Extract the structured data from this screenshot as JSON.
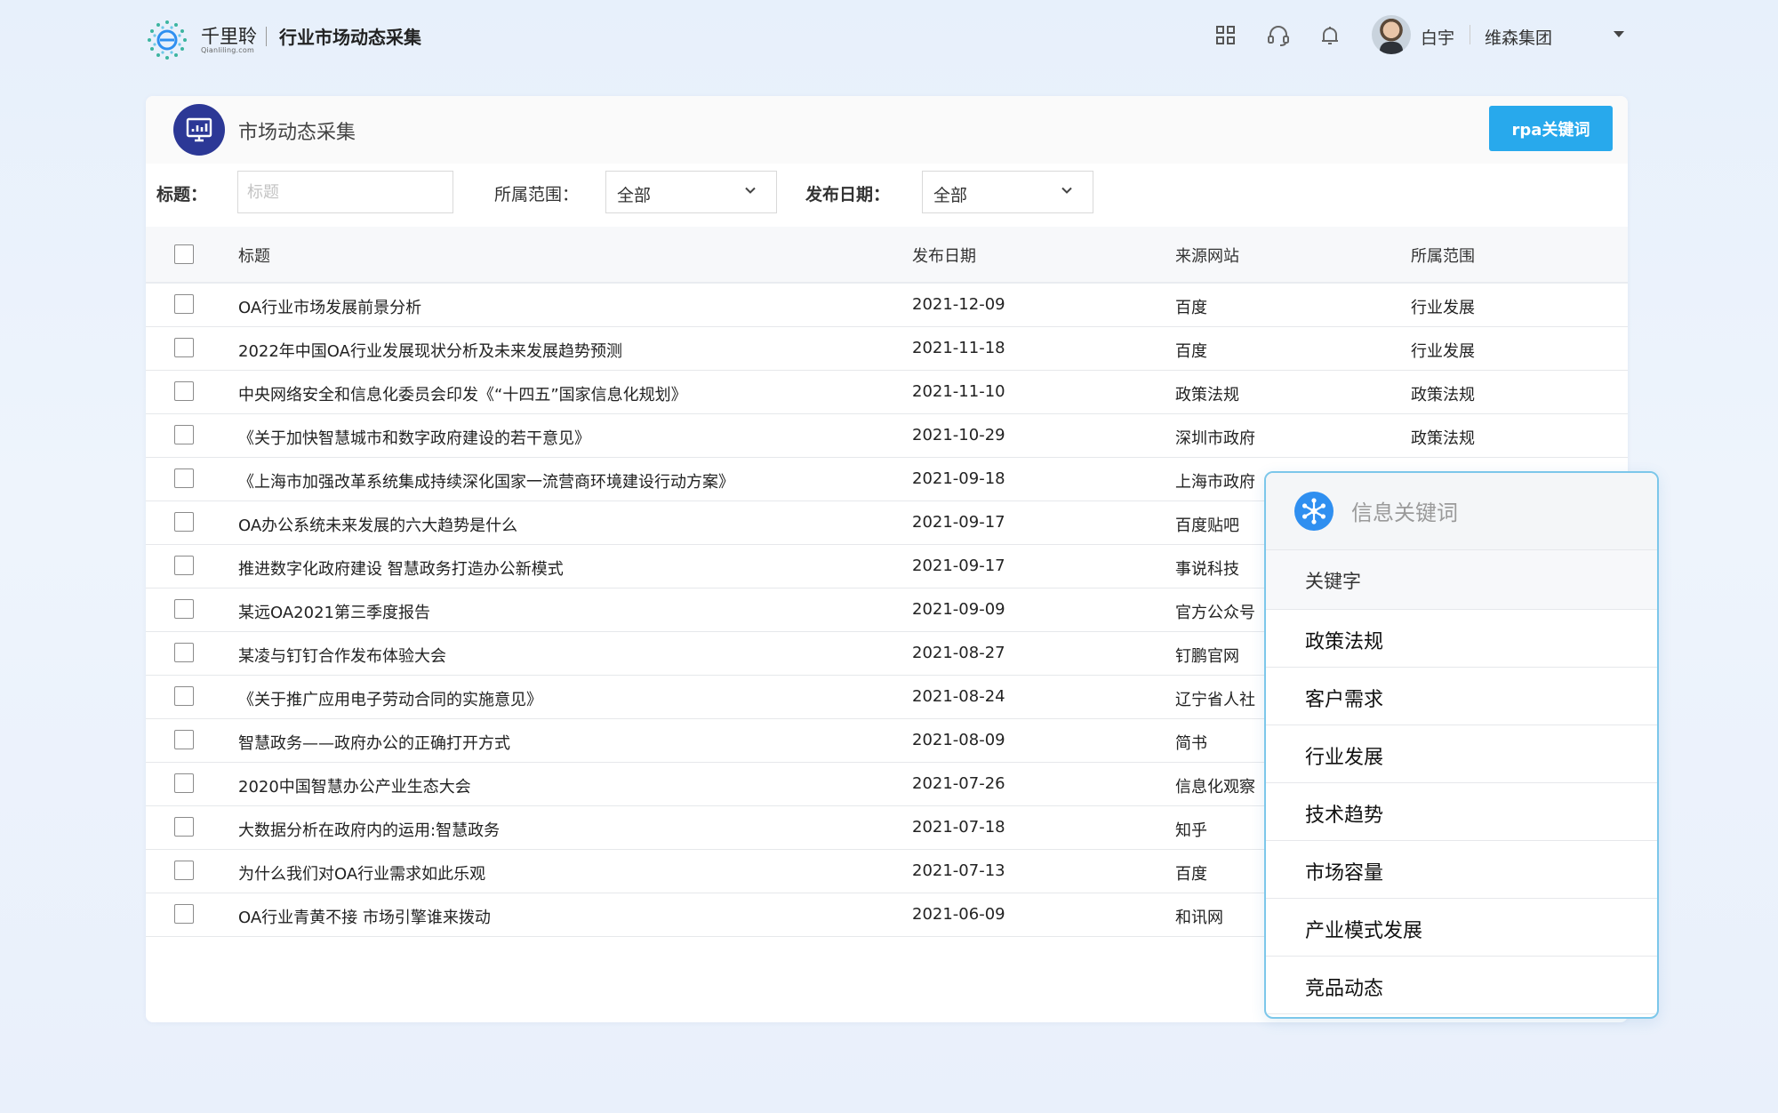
{
  "brand": {
    "name": "千里聆",
    "sub": "Qianliling.com",
    "app_title": "行业市场动态采集"
  },
  "header_icons": [
    "grid-icon",
    "headset-icon",
    "bell-icon"
  ],
  "user": {
    "name": "白宇",
    "org": "维森集团"
  },
  "page": {
    "title": "市场动态采集",
    "rpa_button": "rpa关键词"
  },
  "filters": {
    "title_label": "标题：",
    "title_placeholder": "标题",
    "scope_label": "所属范围：",
    "scope_value": "全部",
    "date_label": "发布日期：",
    "date_value": "全部"
  },
  "table": {
    "columns": [
      "标题",
      "发布日期",
      "来源网站",
      "所属范围"
    ],
    "rows": [
      {
        "title": "OA行业市场发展前景分析",
        "date": "2021-12-09",
        "source": "百度",
        "scope": "行业发展"
      },
      {
        "title": "2022年中国OA行业发展现状分析及未来发展趋势预测",
        "date": "2021-11-18",
        "source": "百度",
        "scope": "行业发展"
      },
      {
        "title": "中央网络安全和信息化委员会印发《“十四五”国家信息化规划》",
        "date": "2021-11-10",
        "source": "政策法规",
        "scope": "政策法规"
      },
      {
        "title": "《关于加快智慧城市和数字政府建设的若干意见》",
        "date": "2021-10-29",
        "source": "深圳市政府",
        "scope": "政策法规"
      },
      {
        "title": "《上海市加强改革系统集成持续深化国家一流营商环境建设行动方案》",
        "date": "2021-09-18",
        "source": "上海市政府",
        "scope": ""
      },
      {
        "title": "OA办公系统未来发展的六大趋势是什么",
        "date": "2021-09-17",
        "source": "百度贴吧",
        "scope": ""
      },
      {
        "title": "推进数字化政府建设 智慧政务打造办公新模式",
        "date": "2021-09-17",
        "source": "事说科技",
        "scope": ""
      },
      {
        "title": "某远OA2021第三季度报告",
        "date": "2021-09-09",
        "source": "官方公众号",
        "scope": ""
      },
      {
        "title": "某凌与钉钉合作发布体验大会",
        "date": "2021-08-27",
        "source": "钉鹏官网",
        "scope": ""
      },
      {
        "title": "《关于推广应用电子劳动合同的实施意见》",
        "date": "2021-08-24",
        "source": "辽宁省人社",
        "scope": ""
      },
      {
        "title": "智慧政务——政府办公的正确打开方式",
        "date": "2021-08-09",
        "source": "简书",
        "scope": ""
      },
      {
        "title": "2020中国智慧办公产业生态大会",
        "date": "2021-07-26",
        "source": "信息化观察",
        "scope": ""
      },
      {
        "title": "大数据分析在政府内的运用:智慧政务",
        "date": "2021-07-18",
        "source": "知乎",
        "scope": ""
      },
      {
        "title": "为什么我们对OA行业需求如此乐观",
        "date": "2021-07-13",
        "source": "百度",
        "scope": ""
      },
      {
        "title": "OA行业青黄不接 市场引擎谁来拨动",
        "date": "2021-06-09",
        "source": "和讯网",
        "scope": ""
      }
    ]
  },
  "keyword_panel": {
    "title": "信息关键词",
    "subheader": "关键字",
    "items": [
      "政策法规",
      "客户需求",
      "行业发展",
      "技术趋势",
      "市场容量",
      "产业模式发展",
      "竞品动态"
    ]
  },
  "colors": {
    "accent": "#28a9ec",
    "header_icon_bg": "#2c3896",
    "panel_border": "#7cc7ea"
  }
}
